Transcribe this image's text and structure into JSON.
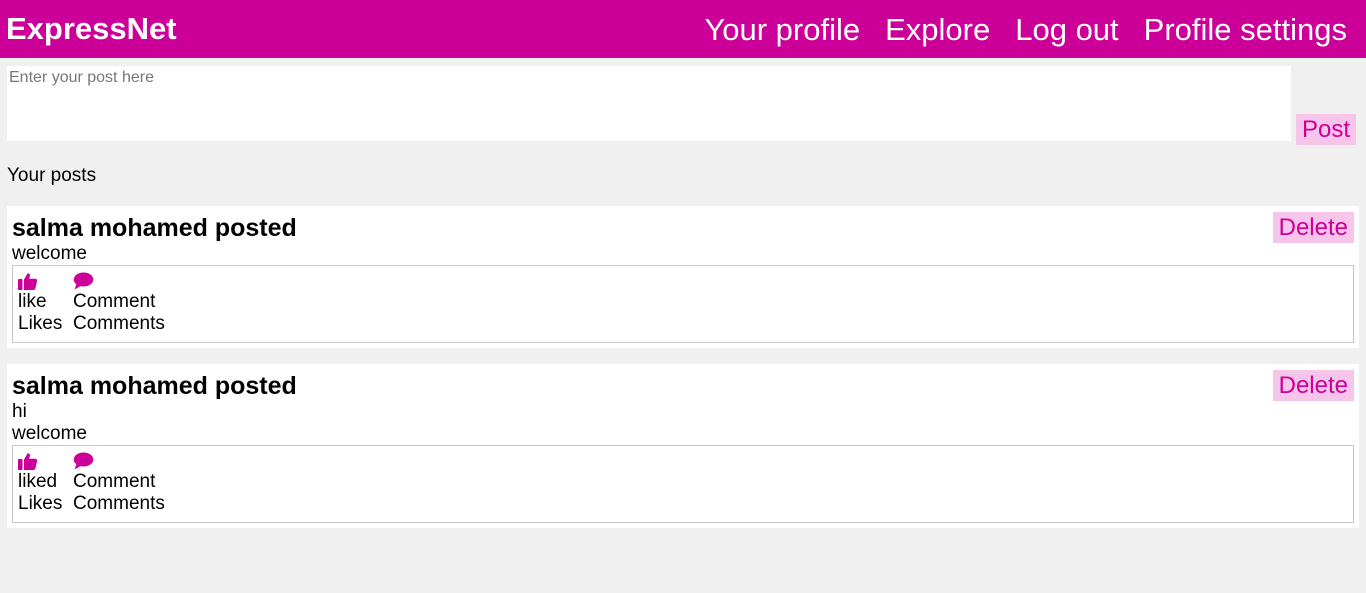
{
  "header": {
    "brand": "ExpressNet",
    "nav": [
      "Your profile",
      "Explore",
      "Log out",
      "Profile settings"
    ],
    "accent": "#cc0099",
    "button_bg": "#f7c4ea"
  },
  "composer": {
    "placeholder": "Enter your post here",
    "post_label": "Post"
  },
  "feed": {
    "title": "Your posts",
    "posts": [
      {
        "author_line": "salma mohamed posted",
        "lines": [
          "welcome"
        ],
        "delete_label": "Delete",
        "like_label": "like",
        "likes_text": "Likes",
        "comment_label": "Comment",
        "comments_text": "Comments",
        "like_icon": "thumbs-up-icon",
        "comment_icon": "comment-icon"
      },
      {
        "author_line": "salma mohamed posted",
        "lines": [
          "hi",
          "welcome"
        ],
        "delete_label": "Delete",
        "like_label": "liked",
        "likes_text": "Likes",
        "comment_label": "Comment",
        "comments_text": "Comments",
        "like_icon": "thumbs-up-icon",
        "comment_icon": "comment-icon"
      }
    ]
  }
}
